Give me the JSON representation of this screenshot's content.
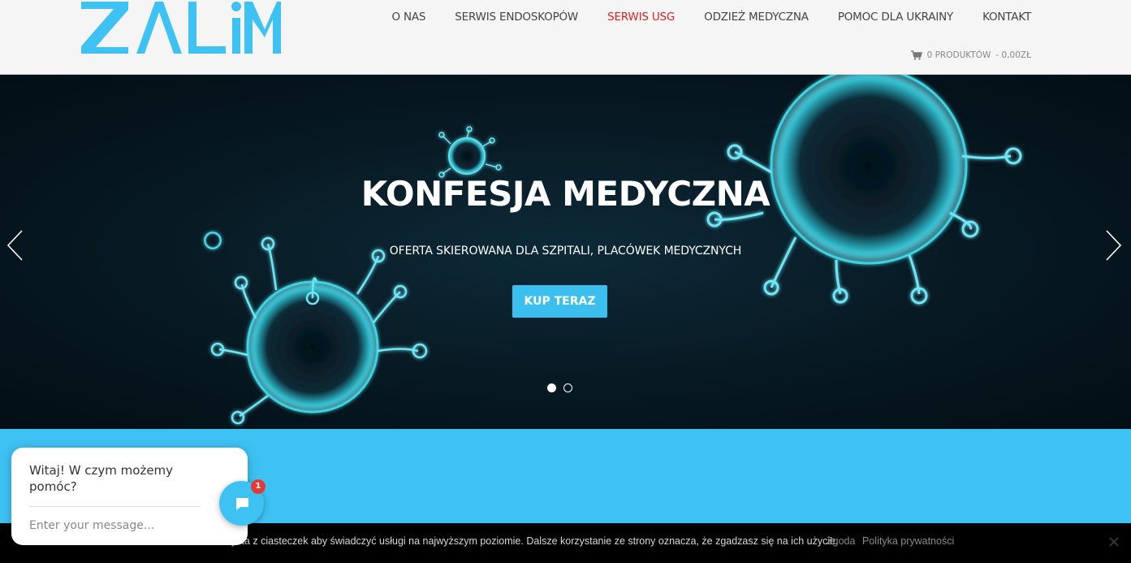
{
  "header": {
    "logo_text": "ZALiM",
    "nav": [
      {
        "label": "O NAS",
        "active": false
      },
      {
        "label": "SERWIS ENDOSKOPÓW",
        "active": false
      },
      {
        "label": "SERWIS USG",
        "active": true
      },
      {
        "label": "ODZIEŻ MEDYCZNA",
        "active": false
      },
      {
        "label": "POMOC DLA UKRAINY",
        "active": false
      },
      {
        "label": "KONTAKT",
        "active": false
      }
    ],
    "cart": {
      "products": "0 PRODUKTÓW",
      "total": "- 0,00ZŁ",
      "icon": "cart-icon"
    }
  },
  "hero": {
    "title": "KONFESJA MEDYCZNA",
    "subtitle": "OFERTA SKIEROWANA DLA SZPITALI, PLACÓWEK MEDYCZNYCH",
    "cta": "KUP TERAZ",
    "slides_total": 2,
    "active_slide": 1
  },
  "cookie_bar": {
    "text": "ysta z ciasteczek aby świadczyć usługi na najwyższym poziomie. Dalsze korzystanie ze strony oznacza, że zgadzasz się na ich użycie.",
    "accept": "Zgoda",
    "privacy": "Polityka prywatności"
  },
  "chat": {
    "greeting": "Witaj! W czym możemy pomóc?",
    "placeholder": "Enter your message...",
    "badge": "1"
  },
  "colors": {
    "accent": "#3ec2f3",
    "nav_active": "#e02020",
    "logo": "#3ec2f3",
    "hero_bg": "#061720"
  }
}
